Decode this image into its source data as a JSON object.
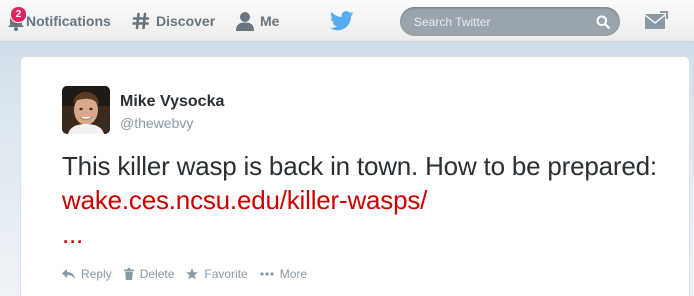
{
  "nav": {
    "notifications_label": "Notifications",
    "notifications_count": "2",
    "discover_label": "Discover",
    "me_label": "Me"
  },
  "search": {
    "placeholder": "Search Twitter"
  },
  "tweet": {
    "fullname": "Mike Vysocka",
    "username": "@thewebvy",
    "text": "This killer wasp is back in town. How to be prepared: ",
    "link": "wake.ces.ncsu.edu/killer-wasps/",
    "ellipsis": "..."
  },
  "actions": {
    "reply": "Reply",
    "delete": "Delete",
    "favorite": "Favorite",
    "more": "More"
  },
  "colors": {
    "accent": "#55acee",
    "link": "#cc0000",
    "badge": "#e0245e",
    "muted": "#8899a6"
  }
}
